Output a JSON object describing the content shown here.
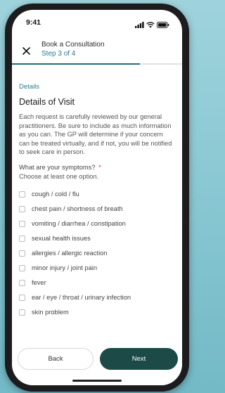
{
  "status_bar": {
    "time": "9:41",
    "icons": [
      "signal-icon",
      "wifi-icon",
      "battery-icon"
    ]
  },
  "header": {
    "title": "Book a Consultation",
    "step": "Step 3 of 4",
    "progress": 0.75
  },
  "section": {
    "label": "Details",
    "title": "Details of Visit",
    "intro": "Each request is carefully reviewed by our general practitioners. Be sure to include as much information as you can. The GP will determine if your concern can be treated virtually, and if not, you will be notified to seek care in person."
  },
  "question": {
    "label": "What are your symptoms?",
    "required_mark": "*",
    "hint": "Choose at least one option."
  },
  "options": [
    {
      "label": "cough / cold / flu"
    },
    {
      "label": "chest pain / shortness of breath"
    },
    {
      "label": "vomiting / diarrhea / constipation"
    },
    {
      "label": "sexual health issues"
    },
    {
      "label": "allergies / allergic reaction"
    },
    {
      "label": "minor injury / joint pain"
    },
    {
      "label": "fever"
    },
    {
      "label": "ear / eye / throat / urinary infection"
    },
    {
      "label": "skin problem"
    }
  ],
  "footer": {
    "back_label": "Back",
    "next_label": "Next"
  },
  "colors": {
    "accent": "#2b7a8e",
    "primary_button": "#1c4a46",
    "required": "#d93a3a",
    "background": "#86c6d1"
  }
}
